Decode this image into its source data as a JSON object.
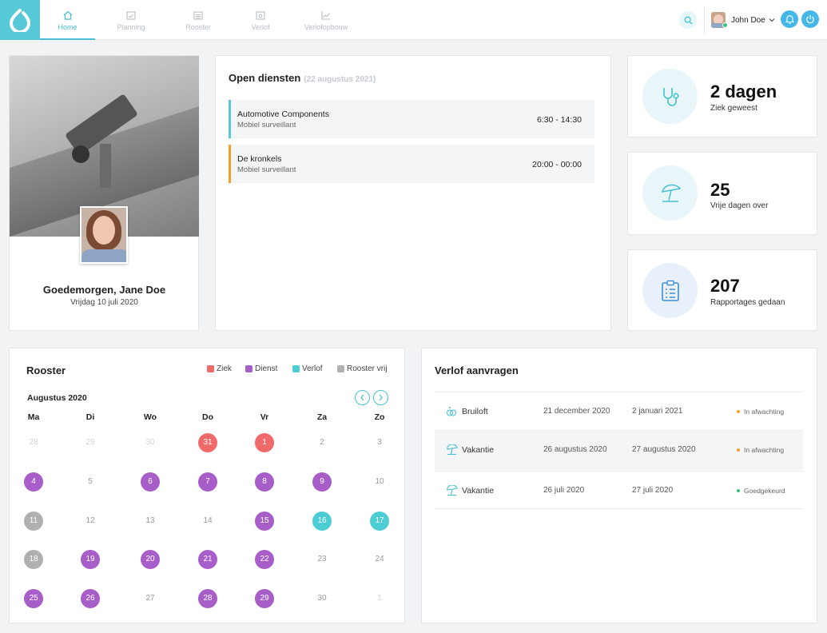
{
  "nav": {
    "items": [
      {
        "label": "Home",
        "icon": "home-icon"
      },
      {
        "label": "Planning",
        "icon": "calendar-check-icon"
      },
      {
        "label": "Rooster",
        "icon": "calendar-grid-icon"
      },
      {
        "label": "Verlof",
        "icon": "calendar-leave-icon"
      },
      {
        "label": "Verlofopbouw",
        "icon": "chart-line-icon"
      }
    ],
    "active": "Home"
  },
  "user": {
    "name": "John Doe"
  },
  "profile": {
    "greeting": "Goedemorgen, Jane Doe",
    "date": "Vrijdag 10 juli 2020"
  },
  "open_shifts": {
    "title": "Open diensten",
    "subtitle": "(22 augustus 2021)",
    "items": [
      {
        "name": "Automotive Components",
        "role": "Mobiel surveillant",
        "time": "6:30 - 14:30",
        "color": "#5bc7d4"
      },
      {
        "name": "De kronkels",
        "role": "Mobiel surveillant",
        "time": "20:00 - 00:00",
        "color": "#f0a12c"
      }
    ]
  },
  "stats": [
    {
      "value": "2 dagen",
      "label": "Ziek geweest",
      "icon": "stethoscope-icon"
    },
    {
      "value": "25",
      "label": "Vrije dagen over",
      "icon": "beach-umbrella-icon"
    },
    {
      "value": "207",
      "label": "Rapportages gedaan",
      "icon": "clipboard-list-icon"
    }
  ],
  "rooster": {
    "title": "Rooster",
    "legend": [
      {
        "label": "Ziek",
        "color": "#f06a6a"
      },
      {
        "label": "Dienst",
        "color": "#a75ec9"
      },
      {
        "label": "Verlof",
        "color": "#4ccdd4"
      },
      {
        "label": "Rooster vrij",
        "color": "#b0b0b0"
      }
    ],
    "month": "Augustus 2020",
    "weekdays": [
      "Ma",
      "Di",
      "Wo",
      "Do",
      "Vr",
      "Za",
      "Zo"
    ],
    "weeks": [
      [
        {
          "d": "28",
          "s": "muted"
        },
        {
          "d": "29",
          "s": "muted"
        },
        {
          "d": "30",
          "s": "muted"
        },
        {
          "d": "31",
          "s": "red"
        },
        {
          "d": "1",
          "s": "red"
        },
        {
          "d": "2",
          "s": ""
        },
        {
          "d": "3",
          "s": ""
        }
      ],
      [
        {
          "d": "4",
          "s": "purple"
        },
        {
          "d": "5",
          "s": ""
        },
        {
          "d": "6",
          "s": "purple"
        },
        {
          "d": "7",
          "s": "purple"
        },
        {
          "d": "8",
          "s": "purple"
        },
        {
          "d": "9",
          "s": "purple"
        },
        {
          "d": "10",
          "s": ""
        }
      ],
      [
        {
          "d": "11",
          "s": "gray"
        },
        {
          "d": "12",
          "s": ""
        },
        {
          "d": "13",
          "s": ""
        },
        {
          "d": "14",
          "s": ""
        },
        {
          "d": "15",
          "s": "purple"
        },
        {
          "d": "16",
          "s": "teal"
        },
        {
          "d": "17",
          "s": "teal"
        }
      ],
      [
        {
          "d": "18",
          "s": "gray"
        },
        {
          "d": "19",
          "s": "purple"
        },
        {
          "d": "20",
          "s": "purple"
        },
        {
          "d": "21",
          "s": "purple"
        },
        {
          "d": "22",
          "s": "purple"
        },
        {
          "d": "23",
          "s": ""
        },
        {
          "d": "24",
          "s": ""
        }
      ],
      [
        {
          "d": "25",
          "s": "purple"
        },
        {
          "d": "26",
          "s": "purple"
        },
        {
          "d": "27",
          "s": ""
        },
        {
          "d": "28",
          "s": "purple"
        },
        {
          "d": "29",
          "s": "purple"
        },
        {
          "d": "30",
          "s": ""
        },
        {
          "d": "1",
          "s": "muted"
        }
      ]
    ]
  },
  "verlof": {
    "title": "Verlof aanvragen",
    "rows": [
      {
        "type": "Bruiloft",
        "from": "21 december 2020",
        "to": "2 januari 2021",
        "status": "In afwachting",
        "status_color": "#f0a12c",
        "icon": "rings-icon"
      },
      {
        "type": "Vakantie",
        "from": "26 augustus 2020",
        "to": "27 augustus 2020",
        "status": "In afwachting",
        "status_color": "#f0a12c",
        "icon": "beach-umbrella-icon"
      },
      {
        "type": "Vakantie",
        "from": "26 juli 2020",
        "to": "27 juli 2020",
        "status": "Goedgekeurd",
        "status_color": "#3ac27c",
        "icon": "beach-umbrella-icon"
      }
    ]
  },
  "colors": {
    "accent": "#45c1d2",
    "brand": "#57c8d6",
    "button": "#45b8e8"
  }
}
